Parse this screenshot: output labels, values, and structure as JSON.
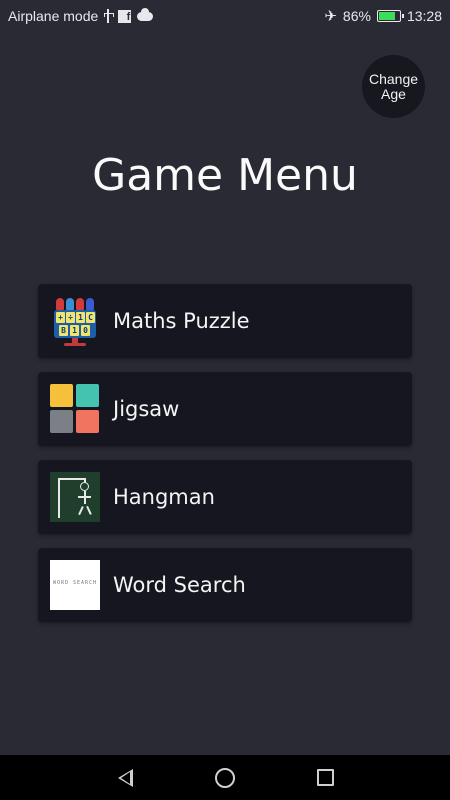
{
  "status_bar": {
    "left_text": "Airplane mode",
    "left_icons": [
      "usb-icon",
      "facebook-icon",
      "cloud-icon"
    ],
    "battery_percent": "86%",
    "battery_level": 0.86,
    "time": "13:28",
    "right_icons": [
      "airplane-icon",
      "battery-charging-icon"
    ]
  },
  "header": {
    "change_age_line1": "Change",
    "change_age_line2": "Age",
    "title": "Game Menu"
  },
  "menu": {
    "items": [
      {
        "label": "Maths Puzzle",
        "icon": "maths-puzzle-icon"
      },
      {
        "label": "Jigsaw",
        "icon": "jigsaw-icon"
      },
      {
        "label": "Hangman",
        "icon": "hangman-icon"
      },
      {
        "label": "Word Search",
        "icon": "word-search-icon"
      }
    ],
    "maths_tiles": [
      "+",
      "÷",
      "1",
      "C",
      "B",
      "1",
      "0"
    ],
    "word_search_thumb_text": "WORD SEARCH"
  },
  "nav_bar": {
    "buttons": [
      "back",
      "home",
      "recents"
    ]
  },
  "colors": {
    "background": "#2a2a34",
    "card": "#161620",
    "battery_fill": "#3ddc5a",
    "jigsaw": [
      "#f5c13b",
      "#43c3b0",
      "#7b7f86",
      "#f07460"
    ]
  }
}
